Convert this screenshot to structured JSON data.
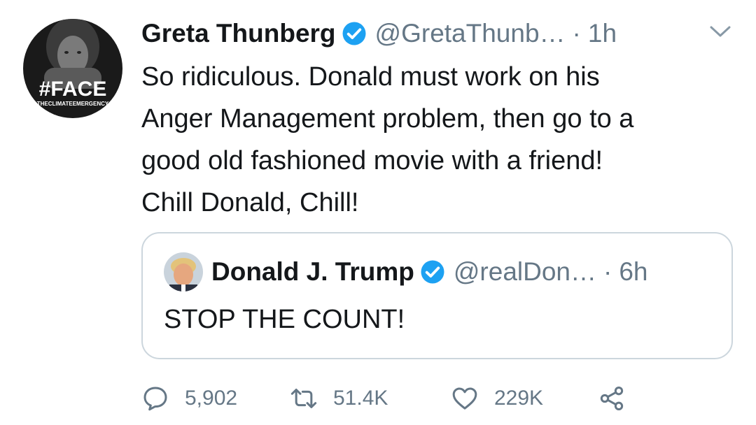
{
  "tweet": {
    "author": {
      "name": "Greta Thunberg",
      "handle": "@GretaThunb…",
      "avatar_overlay_text": "#FACE",
      "avatar_overlay_subtext": "THECLIMATEEMERGENCY"
    },
    "separator": "·",
    "time": "1h",
    "text": "So ridiculous. Donald must work on his\nAnger Management problem, then go to a\ngood old fashioned movie with a friend!\nChill Donald, Chill!",
    "quoted": {
      "name": "Donald J. Trump",
      "handle": "@realDon…",
      "separator": "·",
      "time": "6h",
      "text": "STOP THE COUNT!"
    },
    "actions": {
      "replies": "5,902",
      "retweets": "51.4K",
      "likes": "229K"
    }
  },
  "icons": {
    "verified": "verified-badge-icon",
    "menu": "chevron-down-icon",
    "reply": "reply-icon",
    "retweet": "retweet-icon",
    "like": "heart-icon",
    "share": "share-icon"
  },
  "colors": {
    "text_primary": "#14171a",
    "text_secondary": "#657786",
    "verified_blue": "#1da1f2",
    "border": "#ccd6dd"
  }
}
